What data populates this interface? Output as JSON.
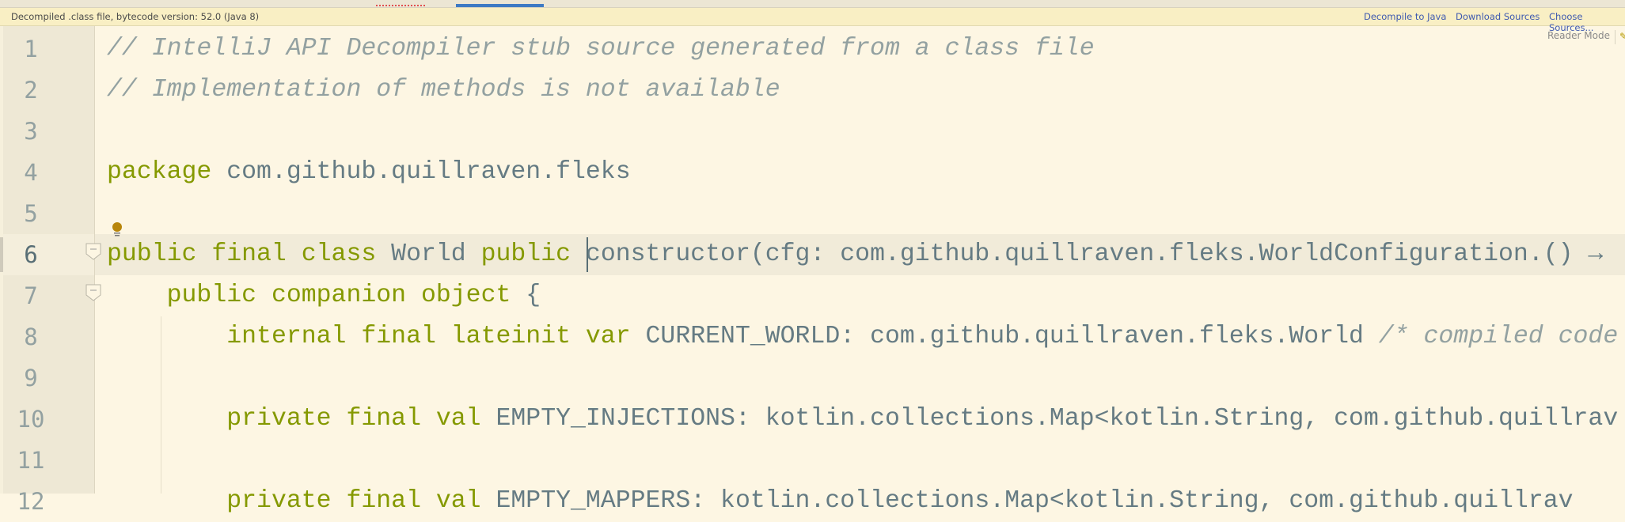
{
  "banner": {
    "message": "Decompiled .class file, bytecode version: 52.0 (Java 8)",
    "links": [
      "Decompile to Java",
      "Download Sources",
      "Choose Sources..."
    ]
  },
  "editor": {
    "reader_mode": "Reader Mode",
    "current_line": 6,
    "colors": {
      "keyword": "#859900",
      "identifier": "#657b83",
      "comment": "#93a1a1",
      "background": "#fdf6e3",
      "gutter": "#eee8d5"
    },
    "lines": [
      {
        "n": "1",
        "tokens": [
          {
            "t": "cm",
            "v": "// IntelliJ API Decompiler stub source generated from a class file"
          }
        ]
      },
      {
        "n": "2",
        "tokens": [
          {
            "t": "cm",
            "v": "// Implementation of methods is not available"
          }
        ]
      },
      {
        "n": "3",
        "tokens": []
      },
      {
        "n": "4",
        "tokens": [
          {
            "t": "kw",
            "v": "package"
          },
          {
            "t": "id",
            "v": " com.github.quillraven.fleks"
          }
        ]
      },
      {
        "n": "5",
        "tokens": []
      },
      {
        "n": "6",
        "tokens": [
          {
            "t": "kw",
            "v": "public final class"
          },
          {
            "t": "id",
            "v": " World "
          },
          {
            "t": "kw",
            "v": "public"
          },
          {
            "t": "id",
            "v": " constructor(cfg: com.github.quillraven.fleks.WorldConfiguration.() →"
          }
        ]
      },
      {
        "n": "7",
        "tokens": [
          {
            "t": "id",
            "v": "    "
          },
          {
            "t": "kw",
            "v": "public companion object"
          },
          {
            "t": "id",
            "v": " {"
          }
        ]
      },
      {
        "n": "8",
        "tokens": [
          {
            "t": "id",
            "v": "        "
          },
          {
            "t": "kw",
            "v": "internal final lateinit var"
          },
          {
            "t": "id",
            "v": " CURRENT_WORLD: com.github.quillraven.fleks.World "
          },
          {
            "t": "cm",
            "v": "/* compiled code"
          }
        ]
      },
      {
        "n": "9",
        "tokens": []
      },
      {
        "n": "10",
        "tokens": [
          {
            "t": "id",
            "v": "        "
          },
          {
            "t": "kw",
            "v": "private final val"
          },
          {
            "t": "id",
            "v": " EMPTY_INJECTIONS: kotlin.collections.Map<kotlin.String, com.github.quillrav"
          }
        ]
      },
      {
        "n": "11",
        "tokens": []
      },
      {
        "n": "12",
        "tokens": [
          {
            "t": "id",
            "v": "        "
          },
          {
            "t": "kw",
            "v": "private final val"
          },
          {
            "t": "id",
            "v": " EMPTY_MAPPERS: kotlin.collections.Map<kotlin.String, com.github.quillrav"
          }
        ]
      }
    ]
  }
}
